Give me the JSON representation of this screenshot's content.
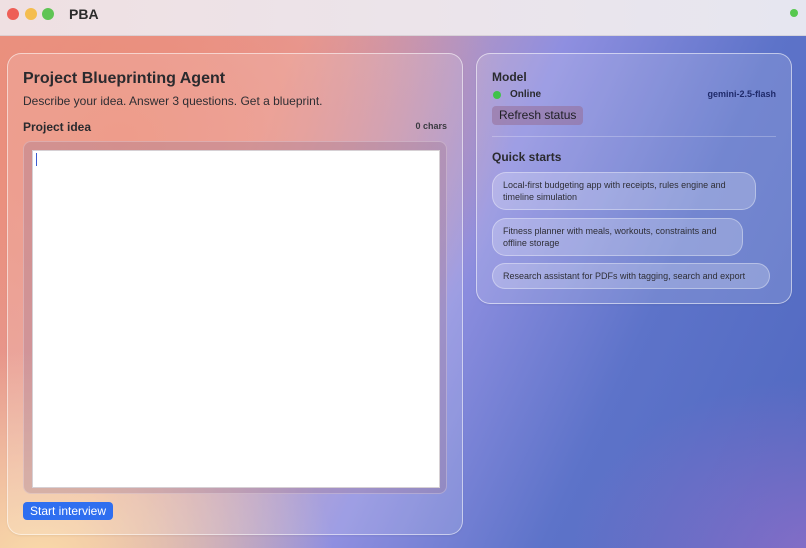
{
  "window": {
    "title": "PBA"
  },
  "left": {
    "heading": "Project Blueprinting Agent",
    "subheading": "Describe your idea. Answer 3 questions. Get a blueprint.",
    "field_label": "Project idea",
    "char_count": "0 chars",
    "textarea_value": "",
    "start_button": "Start interview"
  },
  "right": {
    "model_heading": "Model",
    "status": "Online",
    "status_color": "#3fc24a",
    "model_name": "gemini-2.5-flash",
    "refresh_button": "Refresh status",
    "quick_starts_heading": "Quick starts",
    "quick_starts": [
      {
        "label": "Local-first budgeting app with receipts, rules engine and timeline simulation"
      },
      {
        "label": "Fitness planner with meals, workouts, constraints and offline storage"
      },
      {
        "label": "Research assistant for PDFs with tagging, search and export"
      }
    ]
  },
  "colors": {
    "accent": "#2f6ff0"
  }
}
